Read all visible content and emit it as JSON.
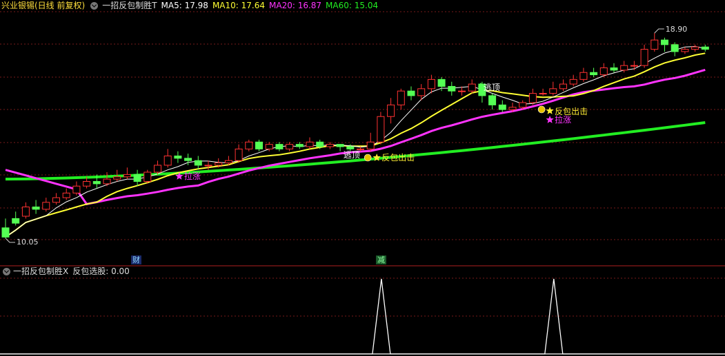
{
  "header": {
    "stock_name": "兴业银锡(日线 前复权)",
    "indicator_name": "一招反包制胜T",
    "ma5": {
      "label": "MA5: 17.98",
      "color": "#ffffff"
    },
    "ma10": {
      "label": "MA10: 17.64",
      "color": "#ffff33"
    },
    "ma20": {
      "label": "MA20: 16.87",
      "color": "#ff33ff"
    },
    "ma60": {
      "label": "MA60: 15.04",
      "color": "#22ee22"
    }
  },
  "price_labels": {
    "high": "18.90",
    "low": "10.05"
  },
  "markers": {
    "fin_tag": "财",
    "reduce_tag": "减",
    "escape_top_1": "逃顶",
    "escape_top_2": "逃顶",
    "rebound_1": "反包出击",
    "rebound_2": "反包出击",
    "rally_1": "拉涨",
    "rally_2": "拉涨"
  },
  "sub_header": {
    "indicator": "一招反包制胜X",
    "value_label": "反包选股: 0.00"
  },
  "colors": {
    "up": "#ff3232",
    "down": "#54ff54",
    "ma5": "#ffffff",
    "ma10": "#ffff33",
    "ma20": "#ff33ff",
    "ma60": "#22ee22",
    "grid": "#7a1a1a",
    "divider": "#b02020"
  },
  "chart_data": {
    "type": "candlestick",
    "price_range": [
      10.05,
      18.9
    ],
    "candles": [
      [
        10.5,
        10.1,
        10.9,
        10.05
      ],
      [
        10.9,
        10.7,
        11.2,
        10.6
      ],
      [
        11.0,
        11.4,
        11.6,
        10.9
      ],
      [
        11.4,
        11.3,
        11.7,
        11.1
      ],
      [
        11.3,
        11.6,
        11.8,
        11.2
      ],
      [
        11.6,
        11.8,
        12.0,
        11.5
      ],
      [
        11.8,
        12.0,
        12.2,
        11.7
      ],
      [
        12.0,
        12.3,
        12.5,
        11.9
      ],
      [
        12.3,
        12.5,
        12.7,
        12.2
      ],
      [
        12.5,
        12.4,
        12.8,
        12.2
      ],
      [
        12.4,
        12.6,
        12.9,
        12.3
      ],
      [
        12.6,
        12.7,
        13.0,
        12.5
      ],
      [
        12.7,
        12.8,
        13.1,
        12.6
      ],
      [
        12.8,
        12.5,
        13.0,
        12.3
      ],
      [
        12.5,
        12.9,
        13.0,
        12.4
      ],
      [
        12.9,
        13.2,
        13.4,
        12.8
      ],
      [
        13.2,
        13.6,
        13.9,
        13.1
      ],
      [
        13.6,
        13.5,
        13.8,
        13.3
      ],
      [
        13.5,
        13.4,
        13.7,
        13.2
      ],
      [
        13.4,
        13.2,
        13.6,
        13.0
      ],
      [
        13.2,
        13.2,
        13.4,
        13.0
      ],
      [
        13.2,
        13.3,
        13.5,
        13.1
      ],
      [
        13.3,
        13.4,
        13.6,
        13.2
      ],
      [
        13.4,
        13.9,
        14.1,
        13.3
      ],
      [
        13.9,
        14.2,
        14.3,
        13.8
      ],
      [
        14.2,
        13.9,
        14.3,
        13.8
      ],
      [
        13.9,
        14.1,
        14.2,
        13.8
      ],
      [
        14.1,
        13.9,
        14.2,
        13.8
      ],
      [
        13.9,
        14.1,
        14.2,
        13.8
      ],
      [
        14.1,
        14.0,
        14.2,
        13.9
      ],
      [
        14.0,
        14.2,
        14.4,
        13.9
      ],
      [
        14.2,
        14.0,
        14.3,
        13.9
      ],
      [
        14.0,
        14.1,
        14.2,
        13.9
      ],
      [
        14.1,
        14.0,
        14.1,
        13.8
      ],
      [
        14.0,
        13.9,
        14.1,
        13.8
      ],
      [
        13.9,
        13.9,
        14.0,
        13.8
      ],
      [
        13.9,
        14.2,
        14.6,
        13.8
      ],
      [
        14.2,
        15.3,
        15.5,
        14.1
      ],
      [
        15.3,
        15.8,
        16.1,
        15.0
      ],
      [
        15.8,
        16.4,
        16.5,
        15.6
      ],
      [
        16.4,
        16.2,
        16.6,
        16.0
      ],
      [
        16.2,
        16.5,
        16.7,
        16.0
      ],
      [
        16.5,
        16.9,
        17.1,
        16.3
      ],
      [
        16.9,
        16.6,
        17.0,
        16.4
      ],
      [
        16.6,
        16.4,
        16.8,
        16.2
      ],
      [
        16.4,
        16.4,
        16.6,
        16.2
      ],
      [
        16.4,
        16.7,
        16.9,
        16.3
      ],
      [
        16.7,
        16.2,
        16.8,
        15.9
      ],
      [
        16.2,
        15.8,
        16.3,
        15.6
      ],
      [
        15.8,
        15.6,
        16.0,
        15.5
      ],
      [
        15.6,
        15.7,
        15.9,
        15.5
      ],
      [
        15.7,
        15.9,
        16.0,
        15.6
      ],
      [
        15.9,
        16.3,
        16.5,
        15.8
      ],
      [
        16.3,
        16.3,
        16.5,
        16.2
      ],
      [
        16.3,
        16.5,
        16.8,
        16.2
      ],
      [
        16.5,
        16.7,
        16.9,
        16.4
      ],
      [
        16.7,
        16.9,
        17.1,
        16.6
      ],
      [
        16.9,
        17.2,
        17.4,
        16.8
      ],
      [
        17.2,
        17.1,
        17.4,
        17.0
      ],
      [
        17.1,
        17.4,
        17.6,
        17.0
      ],
      [
        17.4,
        17.3,
        17.6,
        17.2
      ],
      [
        17.3,
        17.5,
        17.7,
        17.2
      ],
      [
        17.5,
        17.5,
        17.7,
        17.3
      ],
      [
        17.5,
        18.2,
        18.4,
        17.4
      ],
      [
        18.2,
        18.6,
        18.9,
        18.1
      ],
      [
        18.6,
        18.4,
        18.7,
        18.1
      ],
      [
        18.4,
        18.1,
        18.5,
        17.9
      ],
      [
        18.1,
        18.2,
        18.3,
        18.0
      ],
      [
        18.2,
        18.3,
        18.4,
        18.1
      ],
      [
        18.3,
        18.2,
        18.4,
        18.1
      ]
    ],
    "ma5_last": 17.98,
    "ma10_last": 17.64,
    "ma20_last": 16.87,
    "ma60_last": 15.04,
    "signal_peaks": [
      37,
      54
    ]
  }
}
